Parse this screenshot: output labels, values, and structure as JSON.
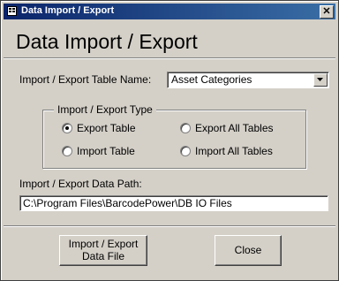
{
  "window": {
    "title": "Data Import / Export",
    "close_glyph": "✕"
  },
  "header": {
    "title": "Data Import / Export"
  },
  "table_name": {
    "label": "Import / Export Table Name:",
    "value": "Asset Categories"
  },
  "type_group": {
    "legend": "Import / Export Type",
    "options": [
      {
        "label": "Export Table",
        "selected": true
      },
      {
        "label": "Export All Tables",
        "selected": false
      },
      {
        "label": "Import Table",
        "selected": false
      },
      {
        "label": "Import All Tables",
        "selected": false
      }
    ]
  },
  "path": {
    "label": "Import / Export Data Path:",
    "value": "C:\\Program Files\\BarcodePower\\DB IO Files"
  },
  "buttons": {
    "import_export_line1": "Import / Export",
    "import_export_line2": "Data File",
    "close": "Close"
  },
  "icons": {
    "app": "database-form-icon",
    "dropdown": "chevron-down-icon"
  }
}
